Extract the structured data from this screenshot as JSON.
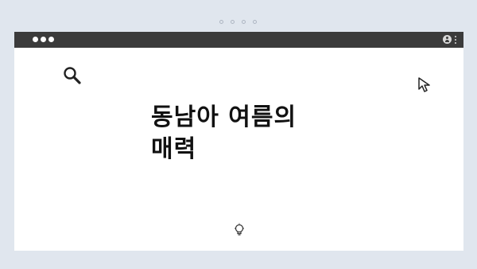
{
  "slide": {
    "headline_line1": "동남아 여름의",
    "headline_line2": "매력"
  },
  "icons": {
    "top_dots": "pagination-dots-icon",
    "window_controls": "window-controls-icon",
    "user": "user-icon",
    "menu": "kebab-menu-icon",
    "search": "search-icon",
    "cursor": "cursor-arrow-icon",
    "bulb": "lightbulb-icon"
  },
  "colors": {
    "background": "#e0e6ee",
    "titlebar": "#3b3b3b",
    "window": "#ffffff",
    "text": "#111111"
  }
}
